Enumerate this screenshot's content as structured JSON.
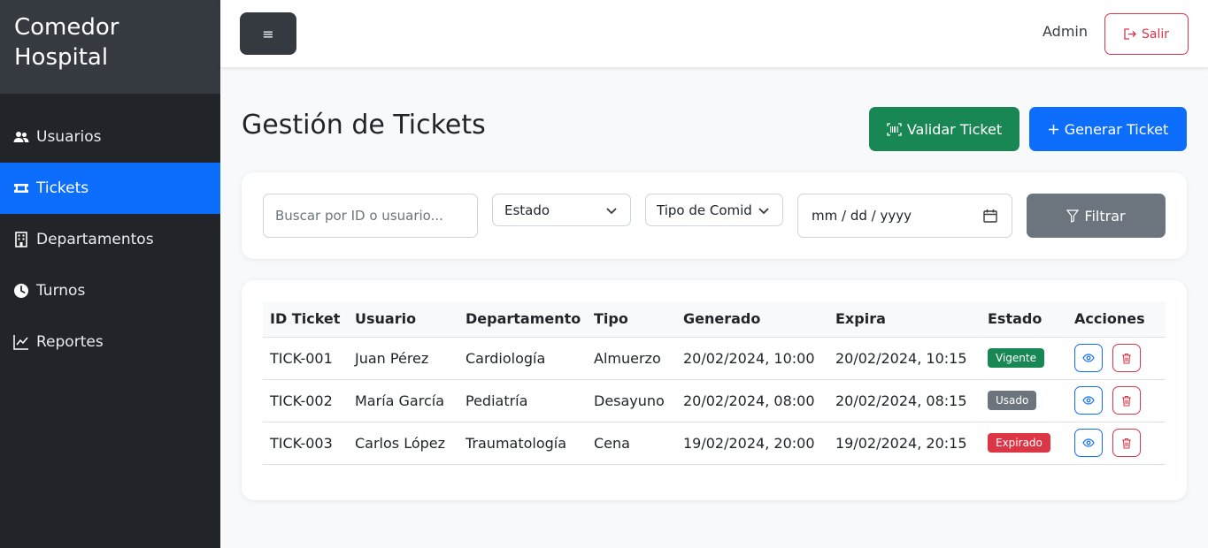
{
  "brand": {
    "line1": "Comedor",
    "line2": "Hospital"
  },
  "sidebar": {
    "items": [
      {
        "label": "Usuarios",
        "icon": "users-icon",
        "active": false
      },
      {
        "label": "Tickets",
        "icon": "ticket-icon",
        "active": true
      },
      {
        "label": "Departamentos",
        "icon": "building-icon",
        "active": false
      },
      {
        "label": "Turnos",
        "icon": "clock-icon",
        "active": false
      },
      {
        "label": "Reportes",
        "icon": "chart-line-icon",
        "active": false
      }
    ]
  },
  "topbar": {
    "toggle_icon": "≡",
    "user": "Admin",
    "logout_label": "Salir"
  },
  "page": {
    "title": "Gestión de Tickets"
  },
  "actions": {
    "validate_label": "Validar Ticket",
    "generate_label": "Generar Ticket"
  },
  "filters": {
    "search_placeholder": "Buscar por ID o usuario...",
    "estado_value": "Estado",
    "tipo_value": "Tipo de Comida",
    "date_value": "mm / dd / yyyy",
    "filter_label": "Filtrar"
  },
  "table": {
    "headers": [
      "ID Ticket",
      "Usuario",
      "Departamento",
      "Tipo",
      "Generado",
      "Expira",
      "Estado",
      "Acciones"
    ],
    "rows": [
      {
        "id": "TICK-001",
        "user": "Juan Pérez",
        "dept": "Cardiología",
        "type": "Almuerzo",
        "generated": "20/02/2024, 10:00",
        "expires": "20/02/2024, 10:15",
        "status": "Vigente",
        "status_color": "#198754"
      },
      {
        "id": "TICK-002",
        "user": "María García",
        "dept": "Pediatría",
        "type": "Desayuno",
        "generated": "20/02/2024, 08:00",
        "expires": "20/02/2024, 08:15",
        "status": "Usado",
        "status_color": "#6c757d"
      },
      {
        "id": "TICK-003",
        "user": "Carlos López",
        "dept": "Traumatología",
        "type": "Cena",
        "generated": "19/02/2024, 20:00",
        "expires": "19/02/2024, 20:15",
        "status": "Expirado",
        "status_color": "#dc3545"
      }
    ]
  },
  "colors": {
    "primary": "#0d6efd",
    "success": "#198754",
    "danger": "#dc3545",
    "secondary": "#6c757d",
    "sidebar": "#212529"
  }
}
